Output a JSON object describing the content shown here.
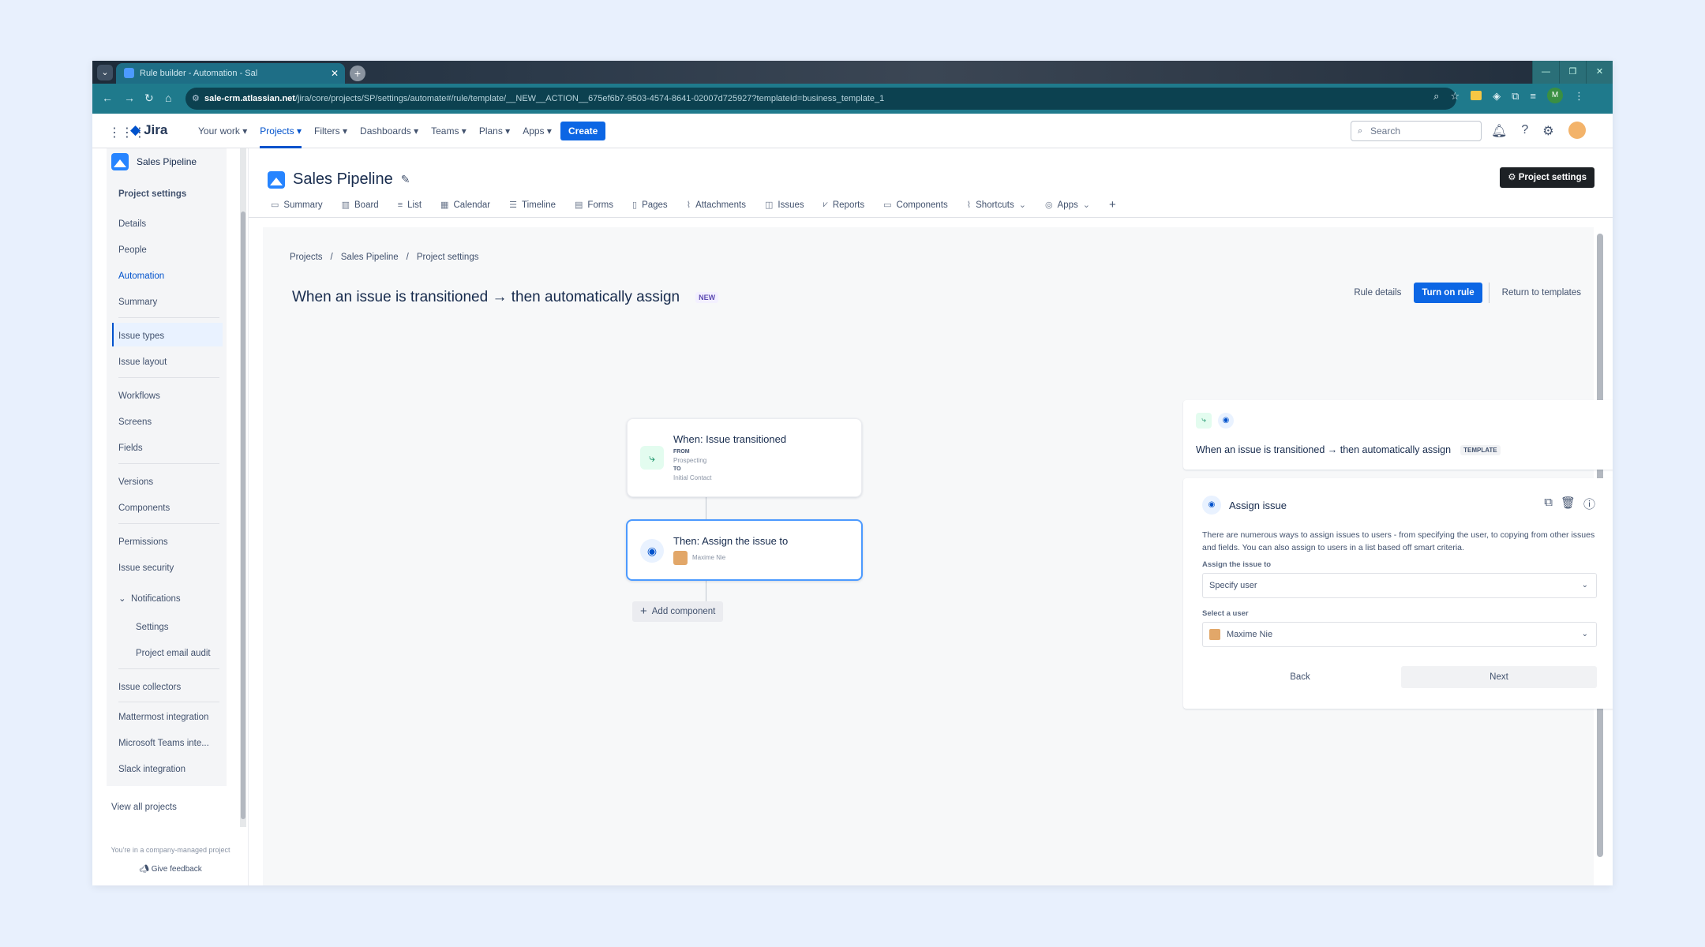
{
  "browser": {
    "tab_title": "Rule builder - Automation - Sal",
    "tab_close": "✕",
    "new_tab": "+",
    "url_host": "sale-crm.atlassian.net",
    "url_path": "/jira/core/projects/SP/settings/automate#/rule/template/__NEW__ACTION__675ef6b7-9503-4574-8641-02007d725927?templateId=business_template_1",
    "profile_initial": "M"
  },
  "topnav": {
    "product": "Jira",
    "menu": [
      "Your work",
      "Projects",
      "Filters",
      "Dashboards",
      "Teams",
      "Plans",
      "Apps"
    ],
    "create_label": "Create",
    "search_placeholder": "Search"
  },
  "sidebar": {
    "project_name": "Sales Pipeline",
    "section_title": "Project settings",
    "items": [
      "Details",
      "People",
      "Automation",
      "Summary",
      "Issue types",
      "Issue layout",
      "Workflows",
      "Screens",
      "Fields",
      "Versions",
      "Components",
      "Permissions",
      "Issue security",
      "Notifications",
      "Settings",
      "Project email audit",
      "Issue collectors",
      "Mattermost integration",
      "Microsoft Teams inte...",
      "Slack integration"
    ],
    "view_all": "View all projects",
    "footer_note": "You're in a company-managed project",
    "feedback": "Give feedback"
  },
  "project": {
    "title": "Sales Pipeline",
    "settings_button": "Project settings",
    "tabs": [
      "Summary",
      "Board",
      "List",
      "Calendar",
      "Timeline",
      "Forms",
      "Pages",
      "Attachments",
      "Issues",
      "Reports",
      "Components",
      "Shortcuts",
      "Apps"
    ]
  },
  "breadcrumb": [
    "Projects",
    "Sales Pipeline",
    "Project settings"
  ],
  "rule": {
    "title": "When an issue is transitioned → then automatically assign",
    "new_badge": "NEW",
    "rule_details": "Rule details",
    "turn_on": "Turn on rule",
    "return_templates": "Return to templates"
  },
  "flow": {
    "trigger_title": "When: Issue transitioned",
    "from_label": "FROM",
    "from_value": "Prospecting",
    "to_label": "TO",
    "to_value": "Initial Contact",
    "action_title": "Then: Assign the issue to",
    "action_user": "Maxime Nie",
    "add_component": "Add component"
  },
  "summary_card": {
    "text": "When an issue is transitioned → then automatically assign",
    "badge": "TEMPLATE"
  },
  "assign_card": {
    "title": "Assign issue",
    "description": "There are numerous ways to assign issues to users - from specifying the user, to copying from other issues and fields. You can also assign to users in a list based off smart criteria.",
    "assign_label": "Assign the issue to",
    "assign_value": "Specify user",
    "user_label": "Select a user",
    "user_value": "Maxime Nie",
    "back": "Back",
    "next": "Next"
  }
}
